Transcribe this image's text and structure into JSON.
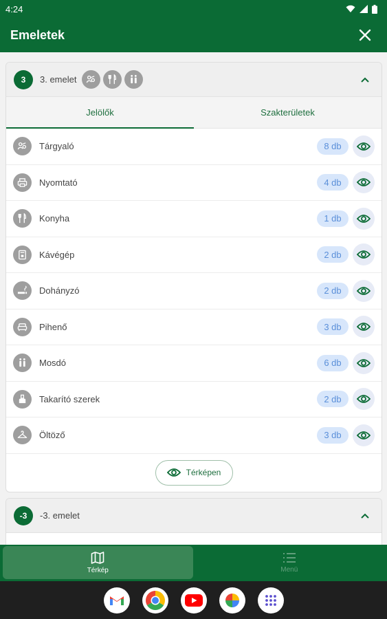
{
  "status": {
    "time": "4:24"
  },
  "appbar": {
    "title": "Emeletek"
  },
  "floors": [
    {
      "badge": "3",
      "name": "3. emelet"
    },
    {
      "badge": "-3",
      "name": "-3. emelet"
    }
  ],
  "tabs": [
    {
      "label": "Jelölők",
      "active": true
    },
    {
      "label": "Szakterületek",
      "active": false
    }
  ],
  "markers": [
    {
      "label": "Tárgyaló",
      "count": "8 db",
      "icon": "meeting-icon"
    },
    {
      "label": "Nyomtató",
      "count": "4 db",
      "icon": "printer-icon"
    },
    {
      "label": "Konyha",
      "count": "1 db",
      "icon": "cutlery-icon"
    },
    {
      "label": "Kávégép",
      "count": "2 db",
      "icon": "coffee-machine-icon"
    },
    {
      "label": "Dohányzó",
      "count": "2 db",
      "icon": "smoking-icon"
    },
    {
      "label": "Pihenő",
      "count": "3 db",
      "icon": "sofa-icon"
    },
    {
      "label": "Mosdó",
      "count": "6 db",
      "icon": "restroom-icon"
    },
    {
      "label": "Takarító szerek",
      "count": "2 db",
      "icon": "cleaning-icon"
    },
    {
      "label": "Öltöző",
      "count": "3 db",
      "icon": "hanger-icon"
    }
  ],
  "map_button": {
    "label": "Térképen"
  },
  "bottom_nav": [
    {
      "label": "Térkép",
      "icon": "map-icon",
      "active": true
    },
    {
      "label": "Menü",
      "icon": "list-icon",
      "active": false
    }
  ],
  "dock_apps": [
    "gmail-icon",
    "chrome-icon",
    "youtube-icon",
    "photos-icon",
    "apps-grid-icon"
  ],
  "colors": {
    "primary": "#0b6b35",
    "badge_bg": "#d7e6fb",
    "badge_text": "#5a8fd9"
  }
}
